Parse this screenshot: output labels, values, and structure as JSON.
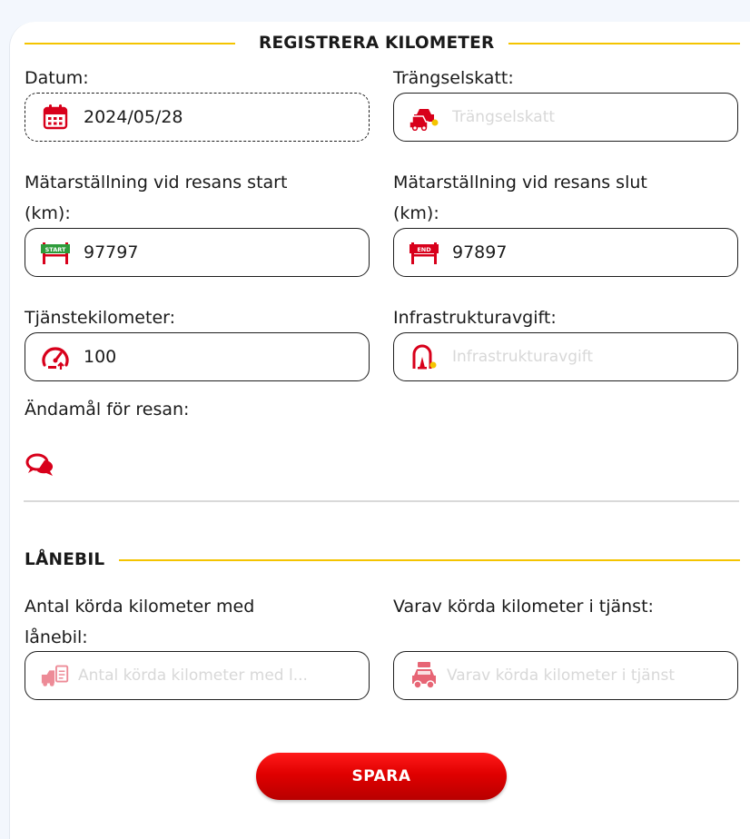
{
  "colors": {
    "accent_yellow": "#f4c400",
    "brand_red": "#e0001b",
    "placeholder_gray": "#d8d8d8"
  },
  "section1": {
    "title": "REGISTRERA KILOMETER"
  },
  "fields": {
    "date": {
      "label": "Datum:",
      "value": "2024/05/28",
      "icon": "calendar-icon"
    },
    "congestion_tax": {
      "label": "Trängselskatt:",
      "placeholder": "Trängselskatt",
      "icon": "traffic-cars-icon"
    },
    "odometer_start": {
      "label_line1": "Mätarställning vid resans start",
      "label_line2": "(km):",
      "value": "97797",
      "icon": "start-gate-icon",
      "icon_text": "START"
    },
    "odometer_end": {
      "label_line1": "Mätarställning vid resans slut",
      "label_line2": "(km):",
      "value": "97897",
      "icon": "end-gate-icon",
      "icon_text": "END"
    },
    "service_km": {
      "label": "Tjänstekilometer:",
      "value": "100",
      "icon": "speedometer-icon"
    },
    "infrastructure_fee": {
      "label": "Infrastrukturavgift:",
      "placeholder": "Infrastrukturavgift",
      "icon": "tunnel-icon"
    },
    "purpose": {
      "label": "Ändamål för resan:",
      "icon": "chat-bubbles-icon"
    }
  },
  "section2": {
    "title": "LÅNEBIL"
  },
  "loan": {
    "total_km": {
      "label_line1": "Antal körda kilometer med",
      "label_line2": "lånebil:",
      "placeholder": "Antal körda kilometer med l...",
      "icon": "car-document-icon"
    },
    "service_km": {
      "label": "Varav körda kilometer i tjänst:",
      "placeholder": "Varav körda kilometer i tjänst",
      "icon": "loan-car-icon"
    }
  },
  "save_button": {
    "label": "SPARA"
  }
}
